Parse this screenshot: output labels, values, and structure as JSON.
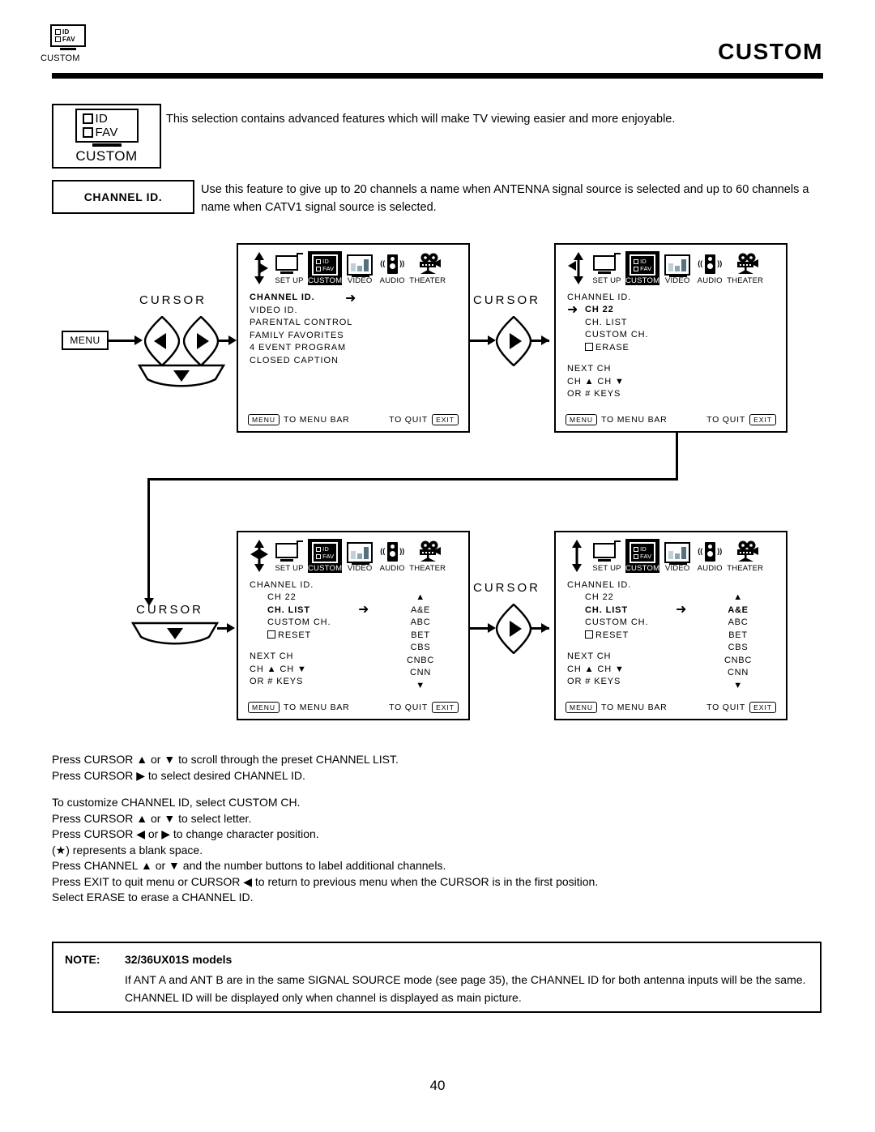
{
  "header": {
    "corner_icon_rows": [
      "ID",
      "FAV"
    ],
    "corner_caption": "CUSTOM",
    "title": "CUSTOM"
  },
  "intro": {
    "badge_rows": [
      "ID",
      "FAV"
    ],
    "badge_word": "CUSTOM",
    "text": "This selection contains advanced features which will make TV viewing easier and more enjoyable."
  },
  "feature": {
    "badge": "CHANNEL ID.",
    "text": "Use this feature to give up to 20 channels a name when ANTENNA signal source is selected and up to 60 channels a name when CATV1 signal source is selected."
  },
  "controls": {
    "cursor_label": "CURSOR",
    "menu_button": "MENU"
  },
  "menu_bar": {
    "items": [
      {
        "icon": "setup-tv-icon",
        "label": "SET UP",
        "selected": false
      },
      {
        "icon": "custom-id-fav-icon",
        "label": "CUSTOM",
        "selected": true
      },
      {
        "icon": "video-monitor-icon",
        "label": "VIDEO",
        "selected": false
      },
      {
        "icon": "audio-speaker-icon",
        "label": "AUDIO",
        "selected": false
      },
      {
        "icon": "theater-camera-icon",
        "label": "THEATER",
        "selected": false
      }
    ],
    "custom_icon_rows": [
      "ID",
      "FAV"
    ]
  },
  "osd_footer": {
    "menu_key": "MENU",
    "menu_text": "TO MENU BAR",
    "quit_text": "TO QUIT",
    "exit_key": "EXIT"
  },
  "screens": {
    "screen1": {
      "name": "custom-menu-screen",
      "title": "CHANNEL ID.",
      "items": [
        "CHANNEL ID.",
        "VIDEO ID.",
        "PARENTAL CONTROL",
        "FAMILY FAVORITES",
        "4 EVENT PROGRAM",
        "CLOSED CAPTION"
      ],
      "selected_index": 0,
      "nav_hint": "up-down-right"
    },
    "screen2": {
      "name": "channel-id-screen",
      "title": "CHANNEL ID.",
      "items": [
        "CH 22",
        "CH. LIST",
        "CUSTOM CH.",
        "ERASE"
      ],
      "checkbox_item": "ERASE",
      "selected_index": 0,
      "hints": [
        "NEXT CH",
        "CH ▲ CH ▼",
        "OR # KEYS"
      ],
      "nav_hint": "up-down-left"
    },
    "screen3": {
      "name": "channel-list-screen",
      "title": "CHANNEL ID.",
      "items": [
        "CH 22",
        "CH. LIST",
        "CUSTOM CH.",
        "RESET"
      ],
      "checkbox_item": "RESET",
      "selected_index": 1,
      "hints": [
        "NEXT CH",
        "CH ▲ CH ▼",
        "OR # KEYS"
      ],
      "list_up_arrow": "▲",
      "list_down_arrow": "▼",
      "list_values": [
        "A&E",
        "ABC",
        "BET",
        "CBS",
        "CNBC",
        "CNN"
      ],
      "list_selected_index": -1,
      "nav_hint": "all-four"
    },
    "screen4": {
      "name": "channel-list-selected-screen",
      "title": "CHANNEL ID.",
      "items": [
        "CH 22",
        "CH. LIST",
        "CUSTOM CH.",
        "RESET"
      ],
      "checkbox_item": "RESET",
      "selected_index": 1,
      "hints": [
        "NEXT CH",
        "CH ▲ CH ▼",
        "OR # KEYS"
      ],
      "list_up_arrow": "▲",
      "list_down_arrow": "▼",
      "list_values": [
        "A&E",
        "ABC",
        "BET",
        "CBS",
        "CNBC",
        "CNN"
      ],
      "list_selected_index": 0,
      "nav_hint": "up-down"
    }
  },
  "instructions": {
    "group1": [
      "Press CURSOR ▲ or ▼ to scroll through the preset CHANNEL LIST.",
      "Press CURSOR ▶ to select desired CHANNEL ID."
    ],
    "group2": [
      "To customize CHANNEL ID, select CUSTOM CH.",
      "Press CURSOR ▲ or ▼ to select letter.",
      "Press CURSOR ◀ or ▶ to change character position.",
      "(★) represents a blank space.",
      "Press CHANNEL ▲ or ▼  and the number buttons to label additional channels.",
      "Press EXIT to quit menu or CURSOR ◀ to return to previous menu when the CURSOR is in the first position.",
      "Select ERASE to erase a CHANNEL ID."
    ]
  },
  "note": {
    "label": "NOTE:",
    "model": "32/36UX01S models",
    "body": "If ANT A and ANT B are in the same SIGNAL SOURCE mode (see page 35), the CHANNEL ID for both antenna inputs will be the same.   CHANNEL ID will be displayed only when channel is displayed as main picture."
  },
  "page_number": "40",
  "colors": {
    "ink": "#000000",
    "paper": "#ffffff",
    "video_bar_light": "#c2cfd6",
    "video_bar_mid": "#8fa4af",
    "video_bar_dark": "#56707e"
  }
}
